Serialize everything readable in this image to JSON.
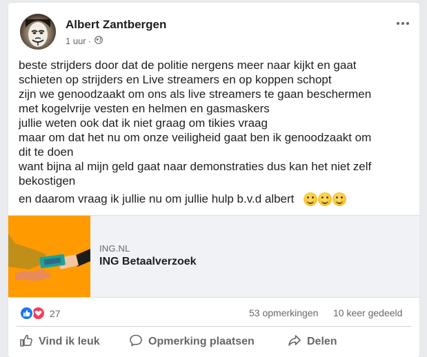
{
  "post": {
    "author": "Albert Zantbergen",
    "time": "1 uur",
    "separator": "·",
    "privacy_icon": "globe-icon",
    "more_icon": "more-options-icon",
    "lines": [
      "beste strijders door dat de politie nergens meer naar kijkt en gaat",
      "schieten op strijders en Live streamers en op koppen schopt",
      "zijn we genoodzaakt om ons als live streamers te gaan beschermen",
      "met kogelvrije vesten en helmen en gasmaskers",
      "jullie weten ook dat ik niet graag om tikies vraag",
      "maar om dat het nu om onze veiligheid gaat ben ik  genoodzaakt om",
      "dit te doen",
      "want bijna al mijn geld gaat naar demonstraties dus kan het niet zelf",
      "bekostigen"
    ],
    "last_line": "en daarom vraag ik jullie nu om jullie hulp b.v.d albert",
    "emojis": [
      "smiling-face-emoji",
      "smiling-face-emoji",
      "smiling-face-emoji"
    ]
  },
  "link": {
    "domain": "ING.NL",
    "title": "ING Betaalverzoek",
    "thumb_bg": "#ff9a00"
  },
  "stats": {
    "reaction_icons": [
      "like-icon",
      "love-icon"
    ],
    "reaction_count": "27",
    "comments": "53 opmerkingen",
    "shares": "10 keer gedeeld"
  },
  "actions": {
    "like": "Vind ik leuk",
    "comment": "Opmerking plaatsen",
    "share": "Delen"
  },
  "colors": {
    "like_blue": "#1877f2",
    "love_red": "#f33e58",
    "text": "#1c1e21",
    "secondary_text": "#65676b"
  }
}
